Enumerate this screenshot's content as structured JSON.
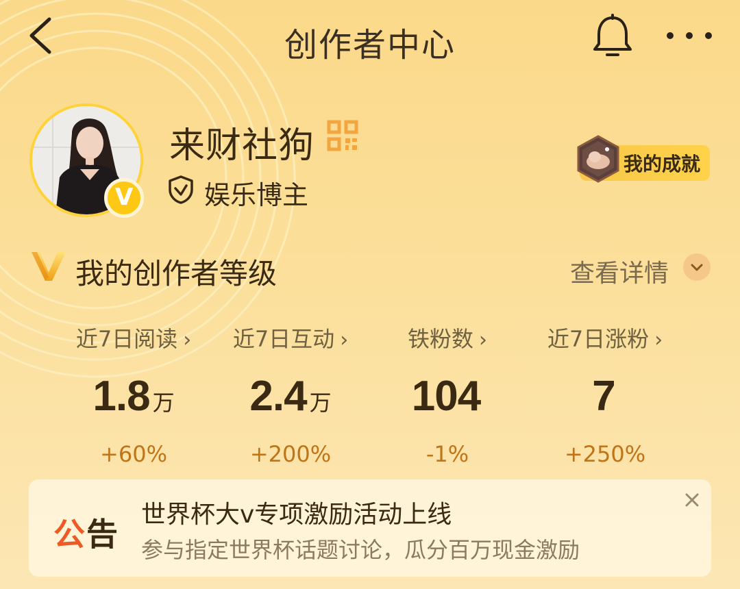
{
  "header": {
    "title": "创作者中心",
    "back_icon": "chevron-left-icon",
    "bell_icon": "bell-icon",
    "more_icon": "more-dots-icon"
  },
  "profile": {
    "username": "来财社狗",
    "role": "娱乐博主",
    "badge": "V",
    "achievement_label": "我的成就"
  },
  "level": {
    "title": "我的创作者等级",
    "detail_label": "查看详情"
  },
  "stats": [
    {
      "label": "近7日阅读",
      "value": "1.8",
      "unit": "万",
      "change": "+60%"
    },
    {
      "label": "近7日互动",
      "value": "2.4",
      "unit": "万",
      "change": "+200%"
    },
    {
      "label": "铁粉数",
      "value": "104",
      "unit": "",
      "change": "-1%"
    },
    {
      "label": "近7日涨粉",
      "value": "7",
      "unit": "",
      "change": "+250%"
    }
  ],
  "notice": {
    "tag_first": "公",
    "tag_second": "告",
    "title": "世界杯大v专项激励活动上线",
    "subtitle": "参与指定世界杯话题讨论，瓜分百万现金激励"
  },
  "colors": {
    "accent": "#ffc814",
    "change": "#c07418",
    "notice_tag": "#ee5a26"
  }
}
